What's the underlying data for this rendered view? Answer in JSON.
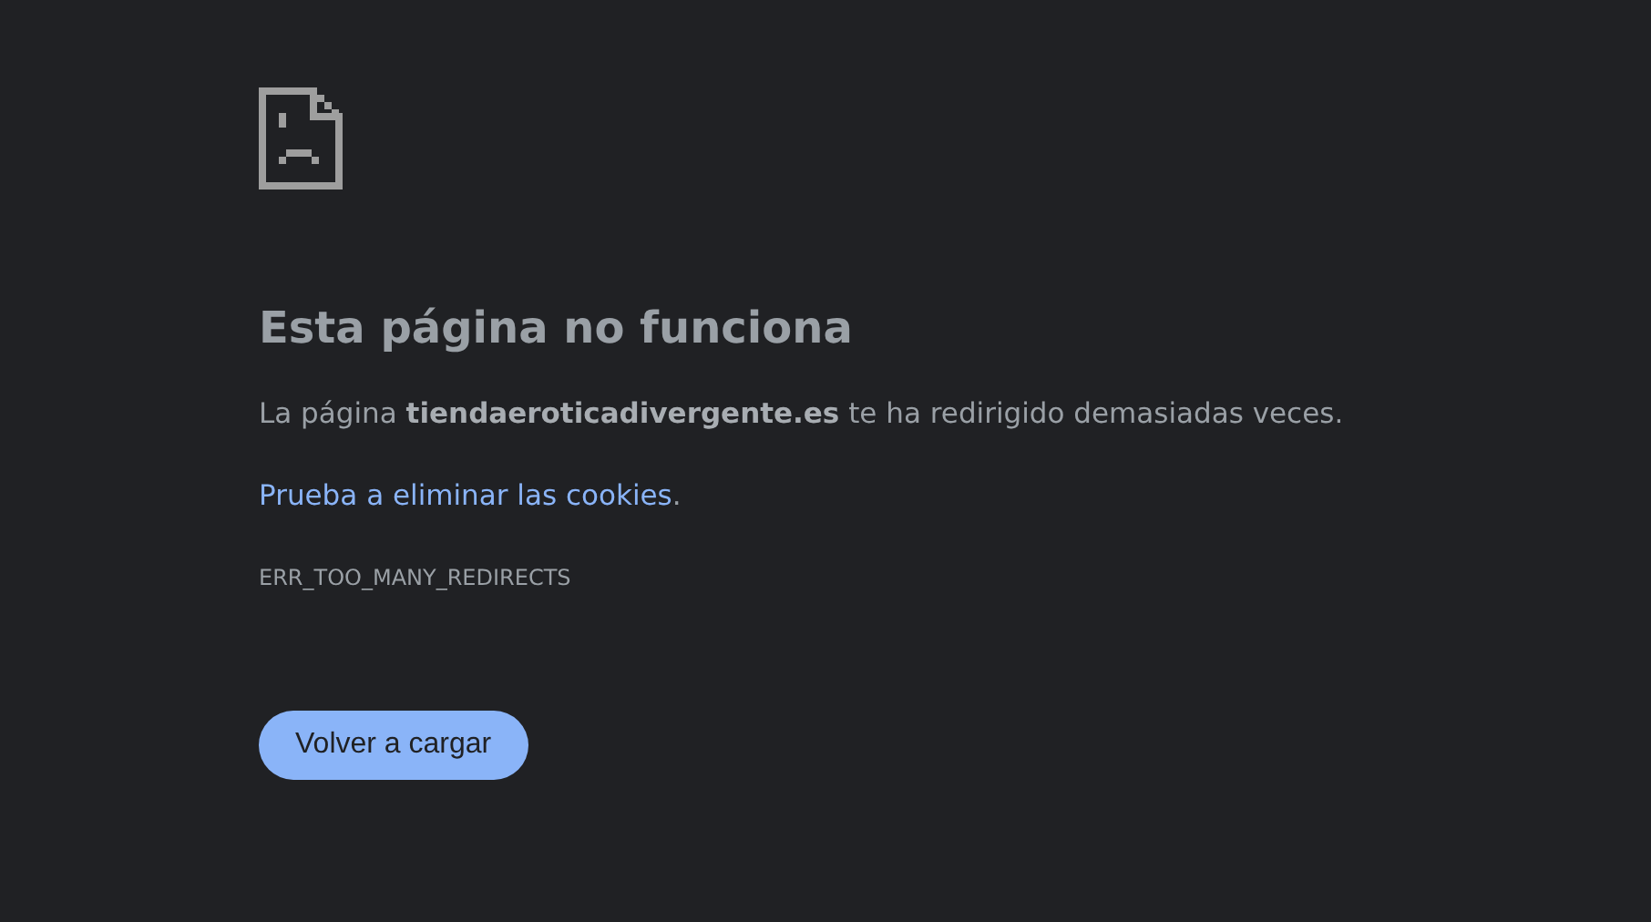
{
  "error_page": {
    "heading": "Esta página no funciona",
    "message": "La página **tiendaeroticadivergente.es** te ha redirigido demasiadas veces.",
    "suggestion": {
      "link": "Prueba a eliminar las cookies",
      "suffix": "."
    },
    "error_code": "ERR_TOO_MANY_REDIRECTS",
    "buttons": [
      "Volver a cargar"
    ]
  }
}
